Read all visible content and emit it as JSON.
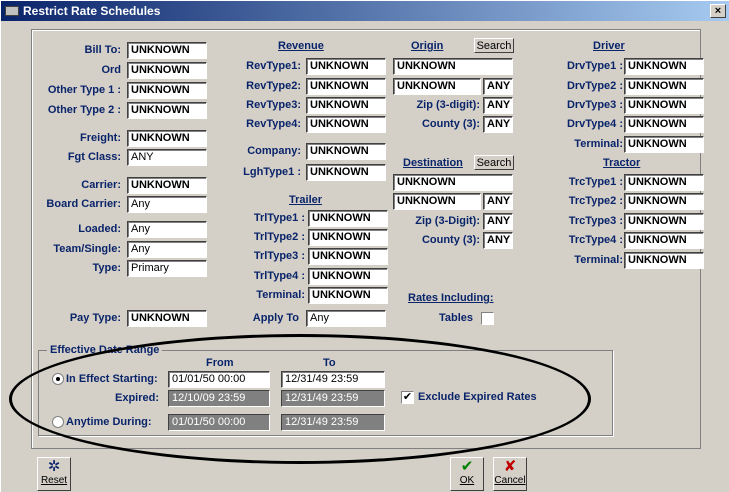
{
  "window": {
    "title": "Restrict Rate Schedules",
    "close": "×"
  },
  "left": {
    "bill_to": {
      "label": "Bill To:",
      "value": "UNKNOWN"
    },
    "ord": {
      "label": "Ord",
      "value": "UNKNOWN"
    },
    "other_type1": {
      "label": "Other Type 1 :",
      "value": "UNKNOWN"
    },
    "other_type2": {
      "label": "Other Type 2 :",
      "value": "UNKNOWN"
    },
    "freight": {
      "label": "Freight:",
      "value": "UNKNOWN"
    },
    "fgt_class": {
      "label": "Fgt Class:",
      "value": "ANY"
    },
    "carrier": {
      "label": "Carrier:",
      "value": "UNKNOWN"
    },
    "board_carrier": {
      "label": "Board Carrier:",
      "value": "Any"
    },
    "loaded": {
      "label": "Loaded:",
      "value": "Any"
    },
    "team_single": {
      "label": "Team/Single:",
      "value": "Any"
    },
    "type": {
      "label": "Type:",
      "value": "Primary"
    },
    "pay_type": {
      "label": "Pay Type:",
      "value": "UNKNOWN"
    }
  },
  "revenue": {
    "header": "Revenue",
    "rev1": {
      "label": "RevType1:",
      "value": "UNKNOWN"
    },
    "rev2": {
      "label": "RevType2:",
      "value": "UNKNOWN"
    },
    "rev3": {
      "label": "RevType3:",
      "value": "UNKNOWN"
    },
    "rev4": {
      "label": "RevType4:",
      "value": "UNKNOWN"
    },
    "company": {
      "label": "Company:",
      "value": "UNKNOWN"
    },
    "lgh_type1": {
      "label": "LghType1 :",
      "value": "UNKNOWN"
    }
  },
  "trailer": {
    "header": "Trailer",
    "trl1": {
      "label": "TrlType1 :",
      "value": "UNKNOWN"
    },
    "trl2": {
      "label": "TrlType2 :",
      "value": "UNKNOWN"
    },
    "trl3": {
      "label": "TrlType3 :",
      "value": "UNKNOWN"
    },
    "trl4": {
      "label": "TrlType4 :",
      "value": "UNKNOWN"
    },
    "terminal": {
      "label": "Terminal:",
      "value": "UNKNOWN"
    },
    "apply_to": {
      "label": "Apply To",
      "value": "Any"
    }
  },
  "origin": {
    "header": "Origin",
    "search": "Search",
    "city": "UNKNOWN",
    "state": "UNKNOWN",
    "state_any": "ANY",
    "zip": {
      "label": "Zip (3-digit):",
      "value": "ANY"
    },
    "county": {
      "label": "County (3):",
      "value": "ANY"
    }
  },
  "destination": {
    "header": "Destination",
    "search": "Search",
    "city": "UNKNOWN",
    "state": "UNKNOWN",
    "state_any": "ANY",
    "zip": {
      "label": "Zip (3-Digit):",
      "value": "ANY"
    },
    "county": {
      "label": "County (3):",
      "value": "ANY"
    }
  },
  "rates_including": {
    "header": "Rates Including:",
    "tables_label": "Tables"
  },
  "driver": {
    "header": "Driver",
    "drv1": {
      "label": "DrvType1 :",
      "value": "UNKNOWN"
    },
    "drv2": {
      "label": "DrvType2 :",
      "value": "UNKNOWN"
    },
    "drv3": {
      "label": "DrvType3 :",
      "value": "UNKNOWN"
    },
    "drv4": {
      "label": "DrvType4 :",
      "value": "UNKNOWN"
    },
    "terminal": {
      "label": "Terminal:",
      "value": "UNKNOWN"
    }
  },
  "tractor": {
    "header": "Tractor",
    "trc1": {
      "label": "TrcType1 :",
      "value": "UNKNOWN"
    },
    "trc2": {
      "label": "TrcType2 :",
      "value": "UNKNOWN"
    },
    "trc3": {
      "label": "TrcType3 :",
      "value": "UNKNOWN"
    },
    "trc4": {
      "label": "TrcType4 :",
      "value": "UNKNOWN"
    },
    "terminal": {
      "label": "Terminal:",
      "value": "UNKNOWN"
    }
  },
  "effective": {
    "title": "Effective Date Range",
    "from_header": "From",
    "to_header": "To",
    "in_effect_label": "In Effect Starting:",
    "in_effect_from": "01/01/50 00:00",
    "in_effect_to": "12/31/49 23:59",
    "expired_label": "Expired:",
    "expired_from": "12/10/09 23:59",
    "expired_to": "12/31/49 23:59",
    "exclude_label": "Exclude Expired Rates",
    "exclude_checked": "✔",
    "anytime_label": "Anytime During:",
    "anytime_from": "01/01/50 00:00",
    "anytime_to": "12/31/49 23:59"
  },
  "buttons": {
    "reset": "Reset",
    "ok": "OK",
    "cancel": "Cancel",
    "reset_glyph": "✲",
    "ok_glyph": "✔",
    "cancel_glyph": "✘"
  },
  "colors": {
    "label_blue": "#0a246a",
    "ok_green": "#008000",
    "cancel_red": "#c00000",
    "face": "#d4d0c8"
  }
}
